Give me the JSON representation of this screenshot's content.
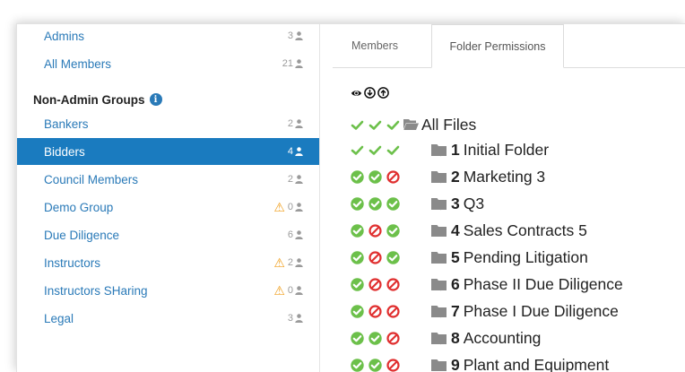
{
  "sidebar": {
    "items": [
      {
        "label": "Admins",
        "count": "3",
        "warning": false,
        "active": false
      },
      {
        "label": "All Members",
        "count": "21",
        "warning": false,
        "active": false
      }
    ],
    "group_header": "Non-Admin Groups",
    "group_items": [
      {
        "label": "Bankers",
        "count": "2",
        "warning": false,
        "active": false
      },
      {
        "label": "Bidders",
        "count": "4",
        "warning": false,
        "active": true
      },
      {
        "label": "Council Members",
        "count": "2",
        "warning": false,
        "active": false
      },
      {
        "label": "Demo Group",
        "count": "0",
        "warning": true,
        "active": false
      },
      {
        "label": "Due Diligence",
        "count": "6",
        "warning": false,
        "active": false
      },
      {
        "label": "Instructors",
        "count": "2",
        "warning": true,
        "active": false
      },
      {
        "label": "Instructors SHaring",
        "count": "0",
        "warning": true,
        "active": false
      },
      {
        "label": "Legal",
        "count": "3",
        "warning": false,
        "active": false
      }
    ]
  },
  "tabs": [
    {
      "label": "Members",
      "active": false
    },
    {
      "label": "Folder Permissions",
      "active": true
    }
  ],
  "permission_headers": [
    "view-icon",
    "download-icon",
    "upload-icon"
  ],
  "tree": {
    "root": {
      "label": "All Files",
      "perms": [
        "check",
        "check",
        "check"
      ]
    },
    "folders": [
      {
        "number": "1",
        "name": "Initial Folder",
        "perms": [
          "check",
          "check",
          "check"
        ],
        "expandable": true
      },
      {
        "number": "2",
        "name": "Marketing 3",
        "perms": [
          "allow",
          "allow",
          "deny"
        ],
        "expandable": true
      },
      {
        "number": "3",
        "name": "Q3",
        "perms": [
          "allow",
          "allow",
          "allow"
        ],
        "expandable": true
      },
      {
        "number": "4",
        "name": "Sales Contracts 5",
        "perms": [
          "allow",
          "deny",
          "allow"
        ],
        "expandable": false
      },
      {
        "number": "5",
        "name": "Pending Litigation",
        "perms": [
          "allow",
          "deny",
          "allow"
        ],
        "expandable": false
      },
      {
        "number": "6",
        "name": "Phase II Due Diligence",
        "perms": [
          "allow",
          "deny",
          "deny"
        ],
        "expandable": true
      },
      {
        "number": "7",
        "name": "Phase I Due Diligence",
        "perms": [
          "allow",
          "deny",
          "deny"
        ],
        "expandable": true
      },
      {
        "number": "8",
        "name": "Accounting",
        "perms": [
          "allow",
          "allow",
          "deny"
        ],
        "expandable": true
      },
      {
        "number": "9",
        "name": "Plant and Equipment",
        "perms": [
          "allow",
          "allow",
          "deny"
        ],
        "expandable": false
      }
    ]
  },
  "colors": {
    "link": "#2a7ab8",
    "active_bg": "#1a7bbf",
    "allow_green": "#6cc04a",
    "deny_red": "#e03030",
    "folder_gray": "#8a8a8a",
    "warning": "#f0a020"
  }
}
